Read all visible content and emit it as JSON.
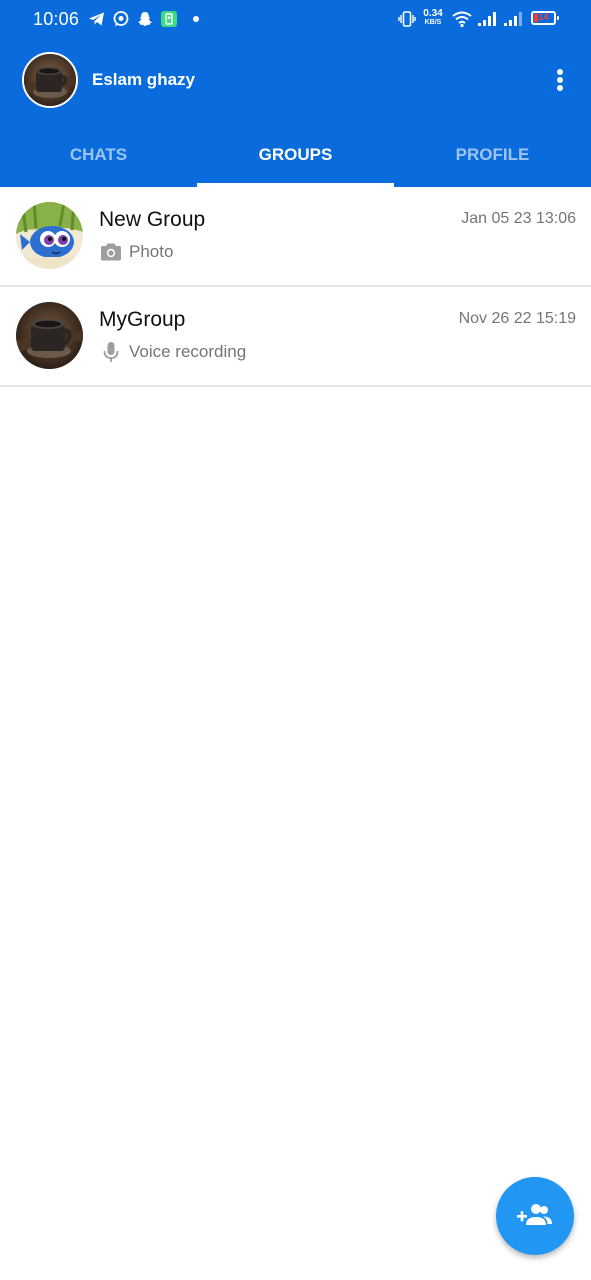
{
  "status_bar": {
    "time": "10:06",
    "net_speed_value": "0.34",
    "net_speed_unit": "KB/S",
    "battery_level": "14",
    "icons": [
      "telegram-icon",
      "whatsapp-icon",
      "snapchat-icon",
      "notification-app-icon",
      "dot-icon",
      "vibrate-icon",
      "wifi-icon",
      "signal-icon",
      "signal-icon-2",
      "battery-icon"
    ]
  },
  "header": {
    "user_name": "Eslam ghazy",
    "menu_icon": "more-vertical-icon"
  },
  "tabs": [
    {
      "label": "CHATS",
      "active": false
    },
    {
      "label": "GROUPS",
      "active": true
    },
    {
      "label": "PROFILE",
      "active": false
    }
  ],
  "groups": [
    {
      "name": "New Group",
      "time": "Jan 05 23 13:06",
      "last_message": "Photo",
      "message_icon": "camera-icon"
    },
    {
      "name": "MyGroup",
      "time": "Nov 26 22 15:19",
      "last_message": "Voice recording",
      "message_icon": "microphone-icon"
    }
  ],
  "fab": {
    "icon": "add-group-icon"
  },
  "colors": {
    "primary": "#0a6cdc",
    "fab": "#2196f3",
    "secondary_text": "#757575",
    "divider": "#e3e3e3",
    "battery_low": "#ff3b30"
  }
}
